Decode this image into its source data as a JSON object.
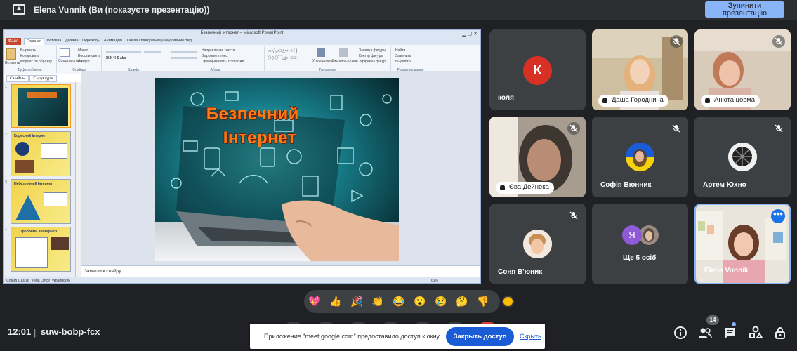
{
  "top_bar": {
    "presenter_title": "Elena Vunnik (Ви (показуєте презентацію))",
    "stop_button": "Зупинити презентацію"
  },
  "powerpoint": {
    "window_title": "Безпечний інтернет – Microsoft PowerPoint",
    "file_tab": "Файл",
    "tabs": [
      "Главная",
      "Вставка",
      "Дизайн",
      "Переходы",
      "Анимация",
      "Показ слайдов",
      "Рецензирование",
      "Вид"
    ],
    "ribbon_groups": [
      "Буфер обмена",
      "Слайды",
      "Шрифт",
      "Абзац",
      "Рисование",
      "Редактирование"
    ],
    "ribbon_items": {
      "paste": "Вставить",
      "cut": "Вырезать",
      "copy": "Копировать",
      "format_painter": "Формат по образцу",
      "new_slide": "Создать слайд",
      "layout": "Макет",
      "reset": "Восстановить",
      "section": "Раздел",
      "text_direction": "Направление текста",
      "align_text": "Выровнять текст",
      "convert_smartart": "Преобразовать в SmartArt",
      "arrange": "Упорядочить",
      "quick_styles": "Экспресс-стили",
      "shape_fill": "Заливка фигуры",
      "shape_outline": "Контур фигуры",
      "shape_effects": "Эффекты фигур",
      "find": "Найти",
      "replace": "Заменить",
      "select": "Выделить"
    },
    "pane_tabs": [
      "Слайды",
      "Структура"
    ],
    "thumbnails": [
      {
        "num": "1",
        "title": ""
      },
      {
        "num": "2",
        "title": "Корисний Інтернет"
      },
      {
        "num": "3",
        "title": "Небезпечний Інтернет"
      },
      {
        "num": "4",
        "title": "Проблеми в Інтернеті"
      }
    ],
    "slide_title_line1": "Безпечний",
    "slide_title_line2": "Інтернет",
    "notes": "Заметки к слайду",
    "status": "Слайд 1 из 16    \"Тема Office\"    украинский",
    "zoom": "61%"
  },
  "participants": [
    {
      "name": "коля",
      "initial": "К",
      "avatar_color": "#d93025"
    },
    {
      "name": "Даша Городнича"
    },
    {
      "name": "Анюта цовма"
    },
    {
      "name": "Єва Дейнека"
    },
    {
      "name": "Софія Вюнник"
    },
    {
      "name": "Артем Юхно"
    },
    {
      "name": "Соня В'юник"
    },
    {
      "name": "Ще 5 осіб",
      "initial": "Я"
    },
    {
      "name": "Elena Vunnik",
      "menu": "•••"
    }
  ],
  "reactions": [
    "💖",
    "👍",
    "🎉",
    "👏",
    "😂",
    "😮",
    "😢",
    "🤔",
    "👎"
  ],
  "bottom_bar": {
    "time": "12:01",
    "separator": "|",
    "meeting_code": "suw-bobp-fcx",
    "people_count": "14"
  },
  "share_notification": {
    "text": "Приложение \"meet.google.com\" предоставило доступ к окну.",
    "stop_button": "Закрыть доступ",
    "hide_link": "Скрыть"
  }
}
